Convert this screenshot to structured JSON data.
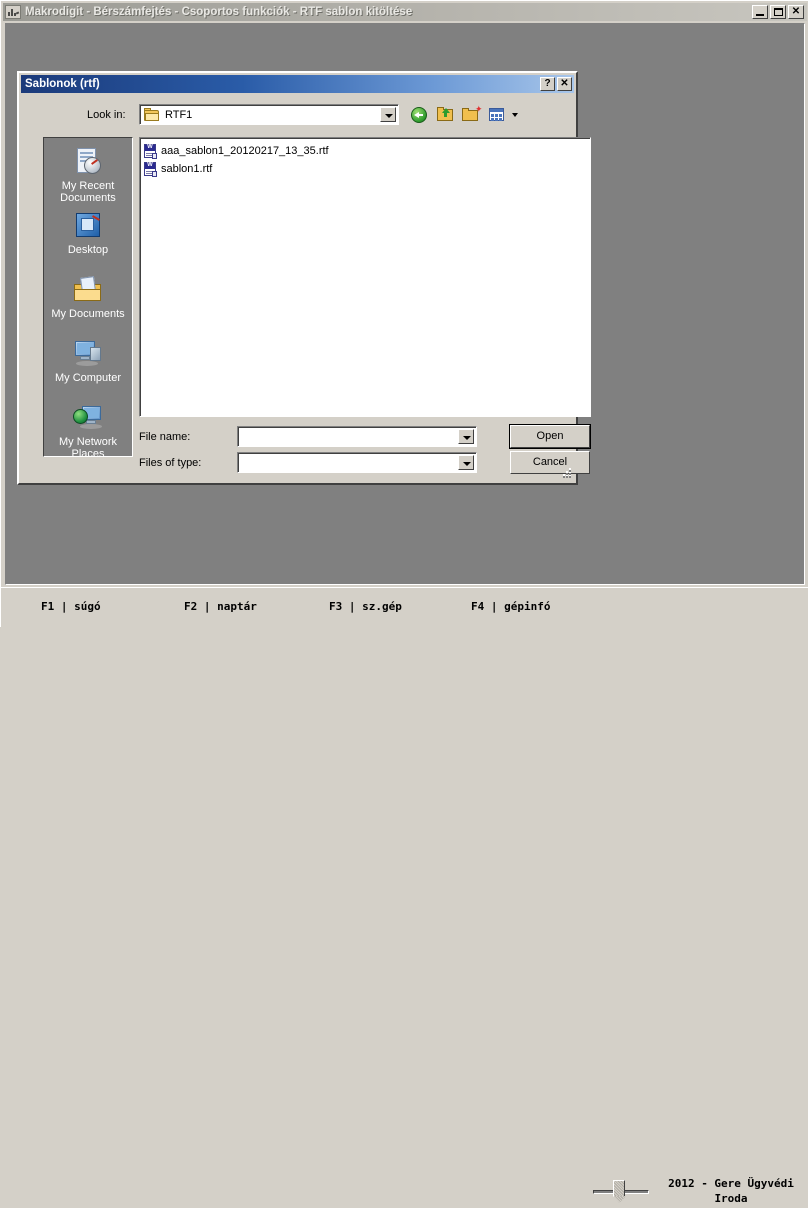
{
  "window": {
    "title": "Makrodigit - Bérszámfejtés  - Csoportos funkciók - RTF sablon kitöltése",
    "app_icon": "chart-app-icon",
    "controls": {
      "minimize": "minimize-button",
      "maximize": "maximize-button",
      "close_label": "✕"
    }
  },
  "dialog": {
    "title": "Sablonok (rtf)",
    "help_label": "?",
    "close_label": "✕",
    "lookin": {
      "label": "Look in:",
      "value": "RTF1",
      "folder_icon": "folder-icon"
    },
    "toolbar": [
      {
        "name": "back-button",
        "icon": "back-arrow-icon"
      },
      {
        "name": "up-one-level-button",
        "icon": "up-folder-icon"
      },
      {
        "name": "create-new-folder-button",
        "icon": "new-folder-icon"
      },
      {
        "name": "views-button",
        "icon": "views-icon"
      }
    ],
    "places": [
      {
        "label": "My Recent Documents",
        "icon": "recent-documents-icon"
      },
      {
        "label": "Desktop",
        "icon": "desktop-icon"
      },
      {
        "label": "My Documents",
        "icon": "my-documents-icon"
      },
      {
        "label": "My Computer",
        "icon": "my-computer-icon"
      },
      {
        "label": "My Network Places",
        "icon": "network-places-icon"
      }
    ],
    "files": [
      {
        "name": "aaa_sablon1_20120217_13_35.rtf",
        "icon": "word-document-icon"
      },
      {
        "name": "sablon1.rtf",
        "icon": "word-document-icon"
      }
    ],
    "filename": {
      "label": "File name:",
      "value": "",
      "placeholder": ""
    },
    "filetype": {
      "label": "Files of type:",
      "value": "",
      "placeholder": ""
    },
    "buttons": {
      "open": "Open",
      "cancel": "Cancel"
    }
  },
  "statusbar": {
    "keys": [
      {
        "label": "F1 | súgó"
      },
      {
        "label": "F2 | naptár"
      },
      {
        "label": "F3 | sz.gép"
      },
      {
        "label": "F4 | gépinfó"
      }
    ],
    "slider": {
      "name": "zoom-slider",
      "value": 50
    },
    "copyright_line1": "2012 - Gere Ügyvédi",
    "copyright_line2": "Iroda"
  },
  "colors": {
    "face": "#d4d0c8",
    "client": "#808080",
    "dialog_title_start": "#1b3a7a",
    "dialog_title_end": "#a8c6ea",
    "list_bg": "#ffffff"
  }
}
